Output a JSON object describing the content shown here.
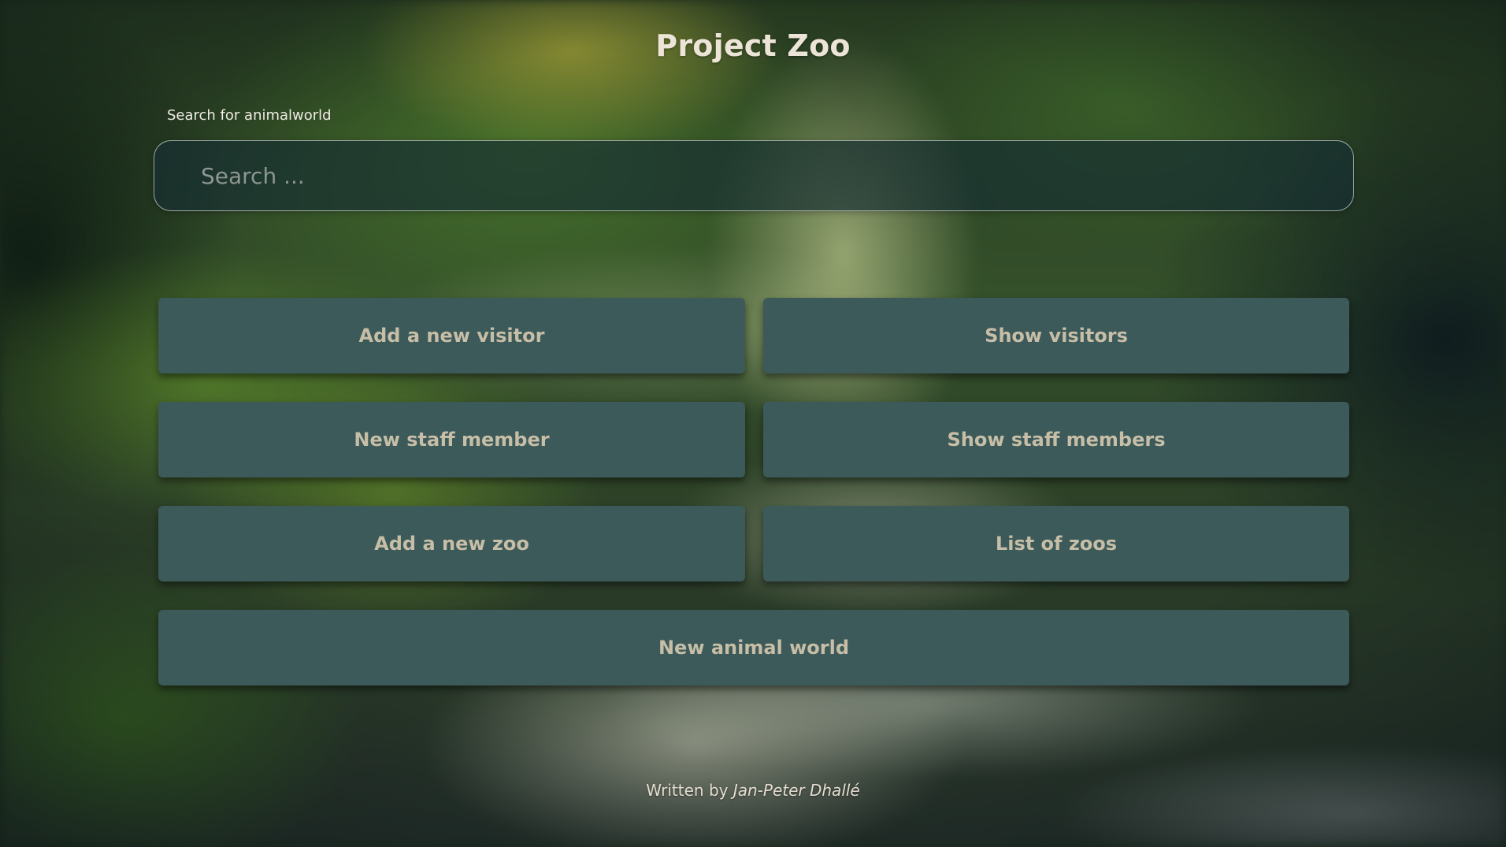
{
  "header": {
    "title": "Project Zoo"
  },
  "search": {
    "label": "Search for animalworld",
    "placeholder": "Search ...",
    "value": ""
  },
  "actions": {
    "add_visitor": "Add a new visitor",
    "show_visitors": "Show visitors",
    "new_staff": "New staff member",
    "show_staff": "Show staff members",
    "add_zoo": "Add a new zoo",
    "list_zoos": "List of zoos",
    "new_animal_world": "New animal world"
  },
  "footer": {
    "prefix": "Written by",
    "author": "Jan-Peter Dhallé"
  },
  "colors": {
    "button_background": "#3d5a5a",
    "button_text": "#c6bea6",
    "title_text": "#ece4d6"
  }
}
